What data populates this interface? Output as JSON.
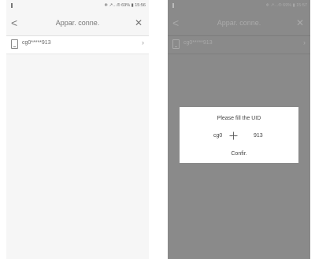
{
  "left": {
    "status": {
      "right": "❄ ↗…® 69% ▮ 15:56"
    },
    "nav": {
      "back": "<",
      "title": "Appar. conne.",
      "close": "✕"
    },
    "device": {
      "name": "cg0*****913",
      "chevron": "›"
    }
  },
  "right": {
    "status": {
      "right": "❄ ↗…® 69% ▮ 15:57"
    },
    "nav": {
      "back": "<",
      "title": "Appar. conne.",
      "close": "✕"
    },
    "device": {
      "name": "cg0*****913",
      "chevron": "›"
    },
    "dialog": {
      "title": "Please fill the UID",
      "uid_prefix": "cg0",
      "uid_suffix": "913",
      "confirm": "Confir."
    }
  }
}
